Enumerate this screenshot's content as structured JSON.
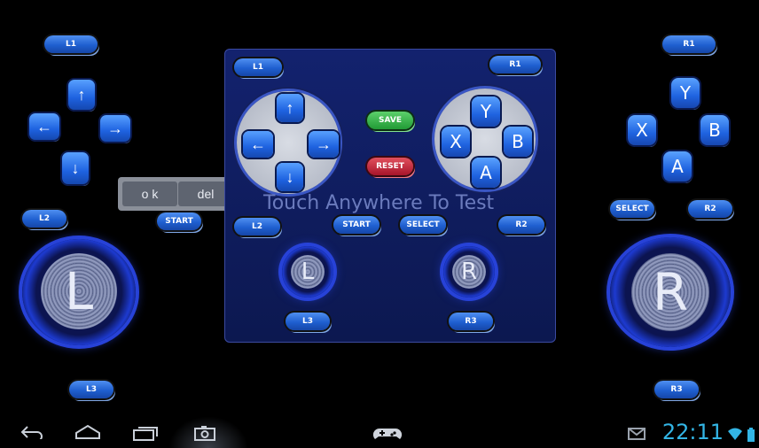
{
  "outer": {
    "l1": "L1",
    "r1": "R1",
    "l2": "L2",
    "r2": "R2",
    "l3": "L3",
    "r3": "R3",
    "start": "START",
    "select": "SELECT",
    "face": {
      "y": "Y",
      "x": "X",
      "b": "B",
      "a": "A"
    },
    "stick_left": "L",
    "stick_right": "R",
    "dpad": {
      "up": "↑",
      "down": "↓",
      "left": "←",
      "right": "→"
    }
  },
  "panel": {
    "l1": "L1",
    "r1": "R1",
    "l2": "L2",
    "r2": "R2",
    "l3": "L3",
    "r3": "R3",
    "start": "START",
    "select": "SELECT",
    "save": "SAVE",
    "reset": "RESET",
    "hint": "Touch Anywhere To Test",
    "face": {
      "y": "Y",
      "x": "X",
      "b": "B",
      "a": "A"
    },
    "stick_left": "L",
    "stick_right": "R",
    "dpad": {
      "up": "↑",
      "down": "↓",
      "left": "←",
      "right": "→"
    }
  },
  "dialog": {
    "ok": "o k",
    "del": "del"
  },
  "statusbar": {
    "time": "22:11"
  },
  "colors": {
    "accent": "#33b5e5",
    "button_blue": "#1f5fd0",
    "save": "#219a35",
    "reset": "#a8142a",
    "panel": "#13226e"
  }
}
